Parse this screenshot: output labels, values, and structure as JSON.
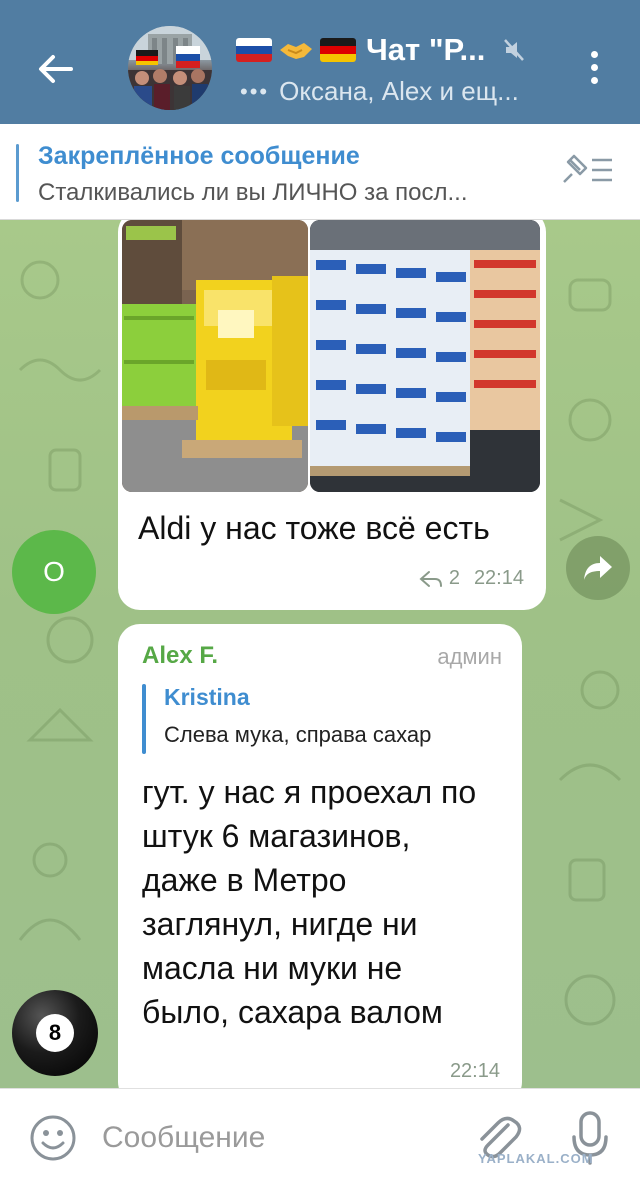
{
  "header": {
    "title": "Чат \"Р...",
    "subtitle": "Оксана, Alex и ещ...",
    "typing_indicator": "•••",
    "icons": [
      "back-arrow-icon",
      "group-avatar",
      "flag-russia-icon",
      "handshake-icon",
      "flag-germany-icon",
      "mute-icon",
      "more-vert-icon"
    ]
  },
  "pinned": {
    "title": "Закреплённое сообщение",
    "text": "Сталкивались ли вы ЛИЧНО за посл..."
  },
  "messages": [
    {
      "avatar_letter": "О",
      "avatar_color": "#5cb84a",
      "text": "Aldi у нас тоже всё есть",
      "reply_count": "2",
      "time": "22:14"
    },
    {
      "sender": "Alex F.",
      "sender_color": "#56a846",
      "role": "админ",
      "reply": {
        "name": "Kristina",
        "text": "Слева мука, справа сахар"
      },
      "text": "гут. у нас я проехал по штук 6 магазинов, даже в Метро заглянул, нигде ни масла ни муки не было, сахара валом",
      "time": "22:14",
      "avatar_label": "8"
    }
  ],
  "input": {
    "placeholder": "Сообщение",
    "value": ""
  },
  "watermark": "YAPLAKAL.COM",
  "colors": {
    "header_bg": "#517da2",
    "link_blue": "#3f8dd0",
    "chat_bg": "#a8c98a"
  }
}
